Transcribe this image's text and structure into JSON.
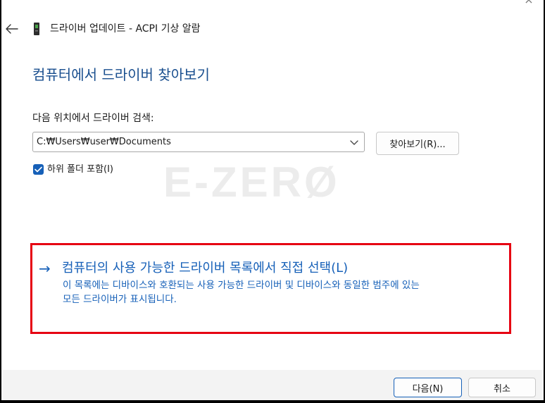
{
  "window": {
    "title": "드라이버 업데이트 - ACPI 기상 알람",
    "close_glyph": "×"
  },
  "heading": "컴퓨터에서 드라이버 찾아보기",
  "search": {
    "label": "다음 위치에서 드라이버 검색:",
    "path_value": "C:₩Users₩user₩Documents",
    "browse_label": "찾아보기(R)..."
  },
  "include_subfolders": {
    "label": "하위 폴더 포함(I)",
    "checked": true
  },
  "watermark": "E-ZERØ",
  "pick_from_list": {
    "arrow": "→",
    "title": "컴퓨터의 사용 가능한 드라이버 목록에서 직접 선택(L)",
    "description_line1": "이 목록에는 디바이스와 호환되는 사용 가능한 드라이버 및 디바이스와 동일한 범주에 있는",
    "description_line2": "모든 드라이버가 표시됩니다."
  },
  "footer": {
    "next_label": "다음(N)",
    "cancel_label": "취소"
  },
  "colors": {
    "accent": "#1660b8",
    "heading": "#1a4f8f",
    "highlight_border": "#e60012",
    "footer_bg": "#f3f3f3"
  },
  "icons": {
    "back": "back-arrow-icon",
    "device": "device-icon",
    "dropdown": "chevron-down-icon",
    "check": "checkmark-icon"
  }
}
